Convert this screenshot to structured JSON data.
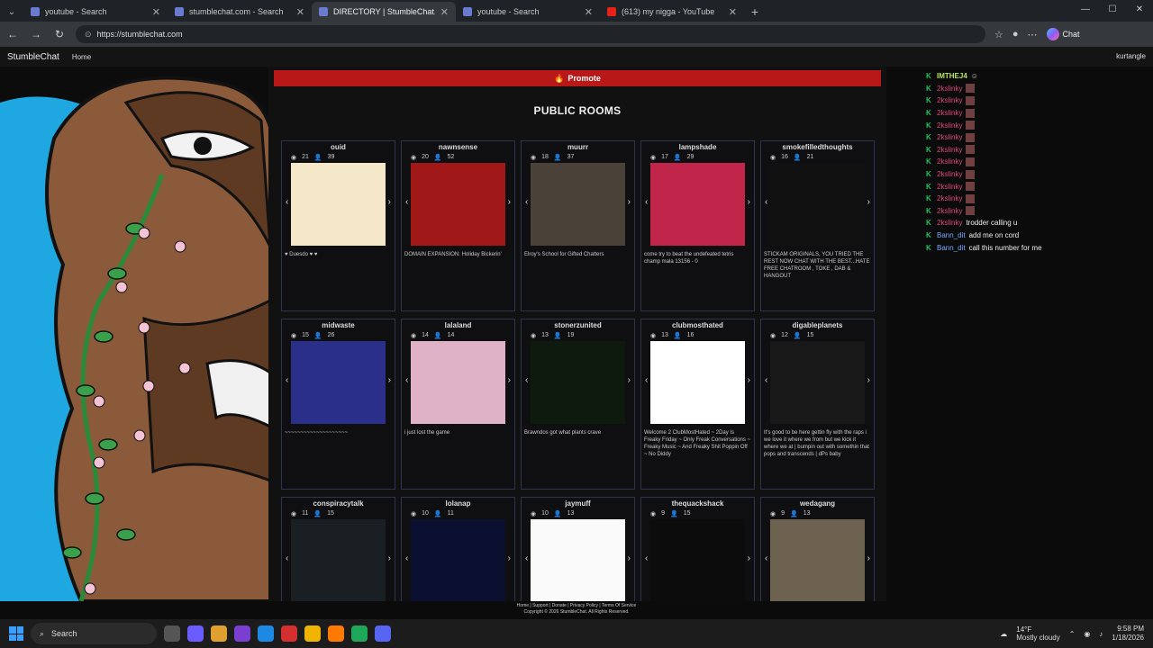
{
  "browser": {
    "tabs": [
      {
        "label": "youtube - Search",
        "active": false,
        "icon": "search-tab-icon"
      },
      {
        "label": "stumblechat.com - Search",
        "active": false,
        "icon": "search-tab-icon"
      },
      {
        "label": "DIRECTORY | StumbleChat.com",
        "active": true,
        "icon": "page-tab-icon"
      },
      {
        "label": "youtube - Search",
        "active": false,
        "icon": "search-tab-icon"
      },
      {
        "label": "(613) my nigga - YouTube",
        "active": false,
        "icon": "youtube-tab-icon"
      }
    ],
    "url": "https://stumblechat.com",
    "chat_label": "Chat"
  },
  "site": {
    "brand": "StumbleChat",
    "home": "Home",
    "user": "kurtangle",
    "promote": "Promote",
    "heading": "PUBLIC ROOMS"
  },
  "rooms": [
    {
      "name": "ouid",
      "viewers": "21",
      "users": "39",
      "desc": "♥ Duesdo ♥ ♥",
      "thumb_color": "#f4e8c8"
    },
    {
      "name": "nawnsense",
      "viewers": "20",
      "users": "52",
      "desc": "DOMAIN EXPANSION: Holiday Bickerin'",
      "thumb_color": "#a01818"
    },
    {
      "name": "muurr",
      "viewers": "18",
      "users": "37",
      "desc": "Elroy's School for Gifted Chatters",
      "thumb_color": "#4a4238"
    },
    {
      "name": "lampshade",
      "viewers": "17",
      "users": "29",
      "desc": "come try to beat the undefeated tetris champ mala 13156 - 0",
      "thumb_color": "#c2254a"
    },
    {
      "name": "smokefilledthoughts",
      "viewers": "16",
      "users": "21",
      "desc": "STICKAM ORIGINALS, YOU TRIED THE REST NOW CHAT WITH THE BEST...HATE FREE CHATROOM , TOKE , DAB & HANGOUT",
      "thumb_color": "#111111"
    },
    {
      "name": "midwaste",
      "viewers": "15",
      "users": "26",
      "desc": "~~~~~~~~~~~~~~~~~~~~",
      "thumb_color": "#2a2f8a"
    },
    {
      "name": "lalaland",
      "viewers": "14",
      "users": "14",
      "desc": "i just lost the game",
      "thumb_color": "#e0b2c8"
    },
    {
      "name": "stonerzunited",
      "viewers": "13",
      "users": "19",
      "desc": "Brawndos got what plants crave",
      "thumb_color": "#0e1a0e"
    },
    {
      "name": "clubmosthated",
      "viewers": "13",
      "users": "16",
      "desc": "Welcome 2 ClubMostHated ~ 2Day Is Freaky Friday ~ Only Freak Conversations ~ Freaky Music ~ And Freaky Shit Poppin Off ~ No Diddy",
      "thumb_color": "#ffffff"
    },
    {
      "name": "digableplanets",
      "viewers": "12",
      "users": "15",
      "desc": "It's good to be here gettin fly with the raps i we love it where we from but we kick it where we at | bumpin out with somethin that pops and transcends | dPs baby",
      "thumb_color": "#181818"
    },
    {
      "name": "conspiracytalk",
      "viewers": "11",
      "users": "15",
      "desc": "",
      "thumb_color": "#1a1f24"
    },
    {
      "name": "lolanap",
      "viewers": "10",
      "users": "11",
      "desc": "",
      "thumb_color": "#0b1030"
    },
    {
      "name": "jaymuff",
      "viewers": "10",
      "users": "13",
      "desc": "",
      "thumb_color": "#fafafa"
    },
    {
      "name": "thequackshack",
      "viewers": "9",
      "users": "15",
      "desc": "",
      "thumb_color": "#0c0c0c"
    },
    {
      "name": "wedagang",
      "viewers": "9",
      "users": "13",
      "desc": "",
      "thumb_color": "#6d6150"
    }
  ],
  "chat": {
    "top_user": "IMTHEJ4",
    "messages": [
      {
        "user": "2kslinky",
        "text": "",
        "color": "#e0457b"
      },
      {
        "user": "2kslinky",
        "text": "",
        "color": "#e0457b"
      },
      {
        "user": "2kslinky",
        "text": "",
        "color": "#e0457b"
      },
      {
        "user": "2kslinky",
        "text": "",
        "color": "#e0457b"
      },
      {
        "user": "2kslinky",
        "text": "",
        "color": "#e0457b"
      },
      {
        "user": "2kslinky",
        "text": "",
        "color": "#e0457b"
      },
      {
        "user": "2kslinky",
        "text": "",
        "color": "#e0457b"
      },
      {
        "user": "2kslinky",
        "text": "",
        "color": "#e0457b"
      },
      {
        "user": "2kslinky",
        "text": "",
        "color": "#e0457b"
      },
      {
        "user": "2kslinky",
        "text": "",
        "color": "#e0457b"
      },
      {
        "user": "2kslinky",
        "text": "",
        "color": "#e0457b"
      },
      {
        "user": "2kslinky",
        "text": "trodder calling u",
        "color": "#e0457b"
      },
      {
        "user": "Bann_dit",
        "text": "add me on cord",
        "color": "#7aa8ff"
      },
      {
        "user": "Bann_dit",
        "text": "call this number for me",
        "color": "#7aa8ff"
      }
    ]
  },
  "footer": {
    "links": "Home | Support | Donate | Privacy Policy | Terms Of Service",
    "copyright": "Copyright © 2026 StumbleChat. All Rights Reserved."
  },
  "taskbar": {
    "search": "Search",
    "temp": "14°F",
    "weather": "Mostly cloudy",
    "time": "9:58 PM",
    "date": "1/18/2026"
  }
}
